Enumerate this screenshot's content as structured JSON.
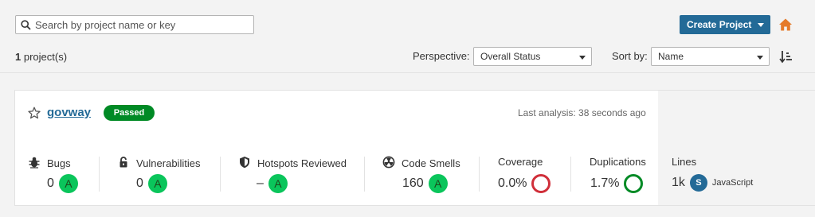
{
  "search": {
    "placeholder": "Search by project name or key",
    "value": ""
  },
  "header": {
    "create_label": "Create Project"
  },
  "toolbar": {
    "count_number": "1",
    "count_suffix": " project(s)",
    "perspective_label": "Perspective:",
    "perspective_value": "Overall Status",
    "sort_label": "Sort by:",
    "sort_value": "Name"
  },
  "project": {
    "name": "govway",
    "status": "Passed",
    "last_analysis": "Last analysis: 38 seconds ago",
    "metrics": {
      "bugs": {
        "label": "Bugs",
        "value": "0",
        "rating": "A"
      },
      "vulnerabilities": {
        "label": "Vulnerabilities",
        "value": "0",
        "rating": "A"
      },
      "hotspots": {
        "label": "Hotspots Reviewed",
        "value": "–",
        "rating": "A"
      },
      "code_smells": {
        "label": "Code Smells",
        "value": "160",
        "rating": "A"
      },
      "coverage": {
        "label": "Coverage",
        "value": "0.0%"
      },
      "duplications": {
        "label": "Duplications",
        "value": "1.7%"
      },
      "lines": {
        "label": "Lines",
        "value": "1k",
        "lang_badge": "S",
        "lang_name": "JavaScript"
      }
    }
  },
  "colors": {
    "accent": "#236a97",
    "passed": "#008a25",
    "rating_a": "#0ac55b",
    "coverage_bad": "#d02f3a",
    "home_icon": "#e57a2a"
  }
}
